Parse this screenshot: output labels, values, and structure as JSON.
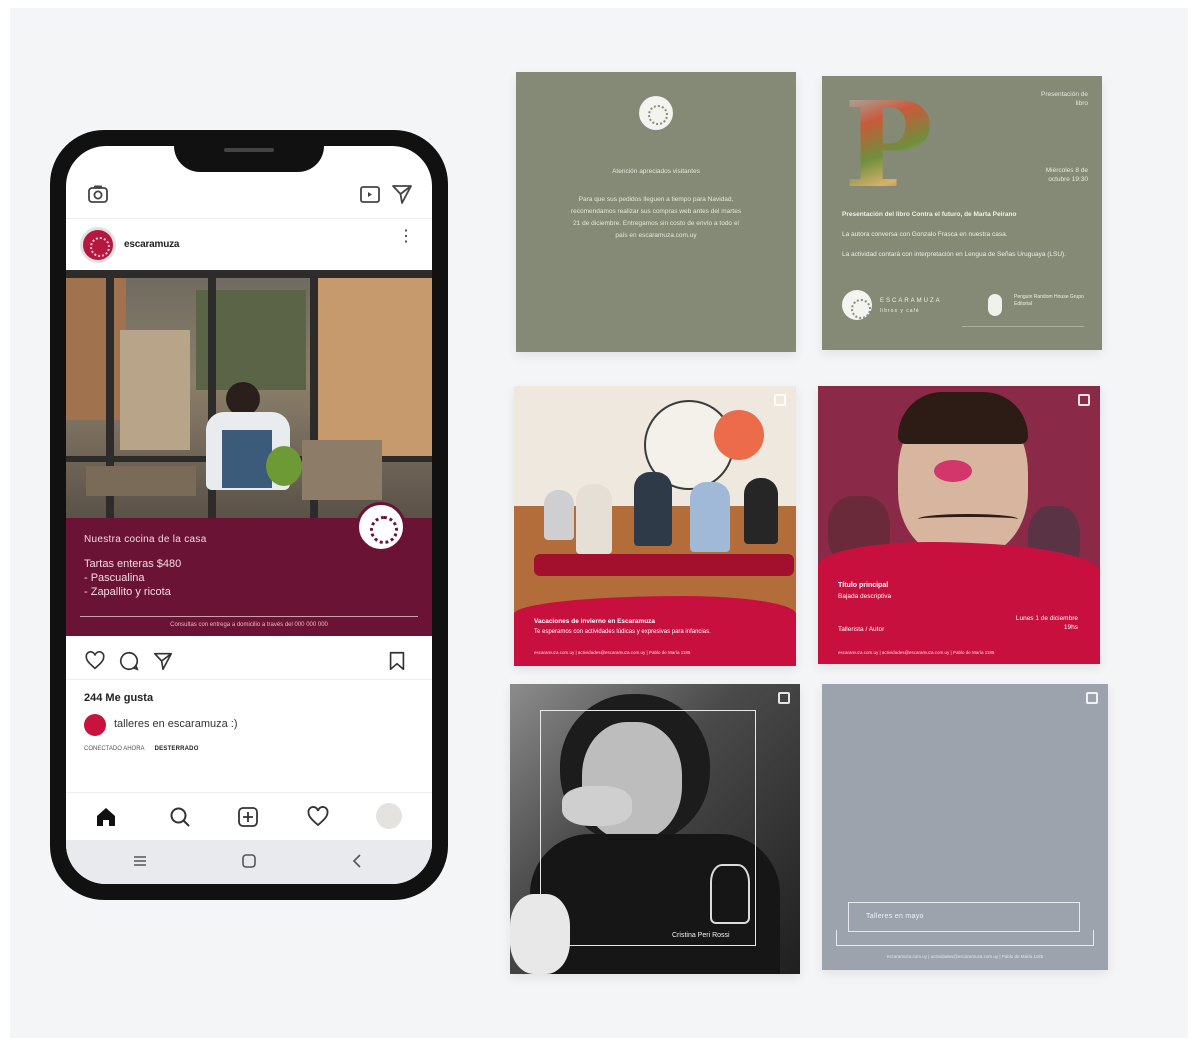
{
  "phone": {
    "profile": {
      "username": "escaramuza"
    },
    "post": {
      "caption_title": "Nuestra cocina de la casa",
      "caption_lines": [
        "Tartas enteras $480",
        "- Pascualina",
        "- Zapallito y ricota"
      ],
      "caption_footer": "Consultas con entrega a domicilio a través del 000 000 000"
    },
    "likes": "244 Me gusta",
    "comment": "talleres en escaramuza :)",
    "meta": {
      "left": "CONECTADO AHORA",
      "right": "DESTERRADO"
    }
  },
  "cards": {
    "announce": {
      "title": "Atención apreciados visitantes",
      "body": "Para que sus pedidos lleguen a tiempo para Navidad, recomendamos realizar sus compras web antes del martes 21 de diciembre. Entregamos sin costo de envío a todo el país en escaramuza.com.uy"
    },
    "book": {
      "big_letter": "P",
      "top_right": "Presentación de libro",
      "date": "Miércoles 8 de octubre 19:30",
      "title": "Presentación del libro Contra el futuro, de Marta Peirano",
      "line1": "La autora conversa con Gonzalo Frasca en nuestra casa.",
      "line2": "La actividad contará con interpretación en Lengua de Señas Uruguaya (LSU).",
      "brand": "ESCARAMUZA",
      "brand_sub": "libros y café",
      "partner": "Penguin Random House Grupo Editorial"
    },
    "kids": {
      "title": "Vacaciones de invierno en Escaramuza",
      "subtitle": "Te esperamos con actividades lúdicas y expresivas para infancias.",
      "footer": "escaramuza.com.uy  |  actividades@escaramuza.com.uy  |  Pablo de María 1185"
    },
    "event": {
      "title": "Título principal",
      "subtitle": "Bajada descriptiva",
      "presenter": "Tallerista / Autor",
      "date": "Lunes 1 de diciembre 19hs",
      "footer": "escaramuza.com.uy  |  actividades@escaramuza.com.uy  |  Pablo de María 1185"
    },
    "portrait": {
      "name": "Cristina Peri Rossi"
    },
    "grey": {
      "label": "Talleres en mayo",
      "footer": "escaramuza.com.uy  |  actividades@escaramuza.com.uy  |  Pablo de María 1185"
    }
  },
  "colors": {
    "wine": "#6b1334",
    "red": "#c8103e",
    "sage": "#848a75",
    "slate": "#9da3ad"
  }
}
